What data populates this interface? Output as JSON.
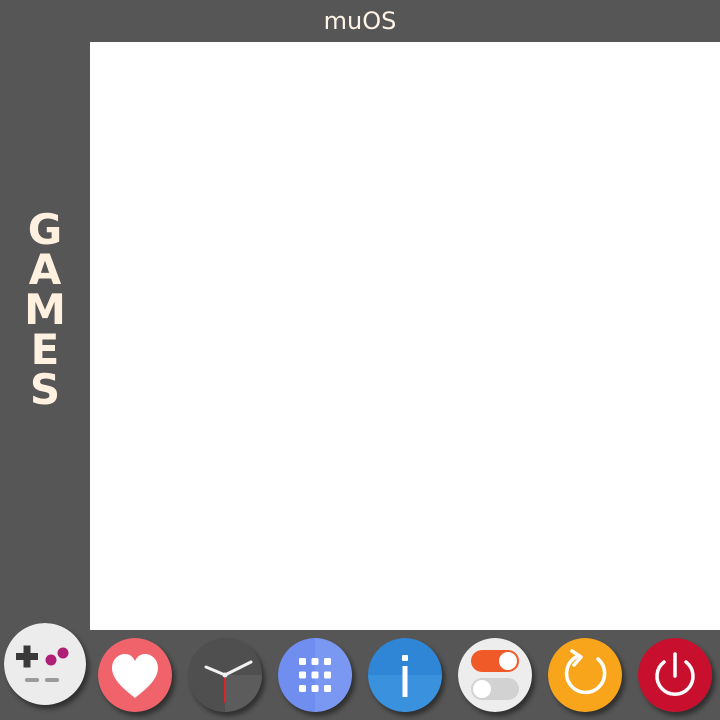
{
  "window": {
    "title": "muOS"
  },
  "side_label": {
    "letters": [
      "G",
      "A",
      "M",
      "E",
      "S"
    ]
  },
  "dock": {
    "items": [
      {
        "icon": "gamepad-icon",
        "selected": true
      },
      {
        "icon": "heart-icon"
      },
      {
        "icon": "clock-icon"
      },
      {
        "icon": "apps-grid-icon"
      },
      {
        "icon": "info-icon"
      },
      {
        "icon": "toggle-switches-icon"
      },
      {
        "icon": "reboot-icon"
      },
      {
        "icon": "power-icon"
      }
    ]
  },
  "colors": {
    "background": "#565656",
    "panel": "#ffffff",
    "label_text": "#fff0df",
    "favourites": "#f0636a",
    "apps": "#6f8ef0",
    "info": "#2f86d6",
    "toggle_on": "#f05a28",
    "reboot": "#f9a51b",
    "power": "#c8102e"
  }
}
